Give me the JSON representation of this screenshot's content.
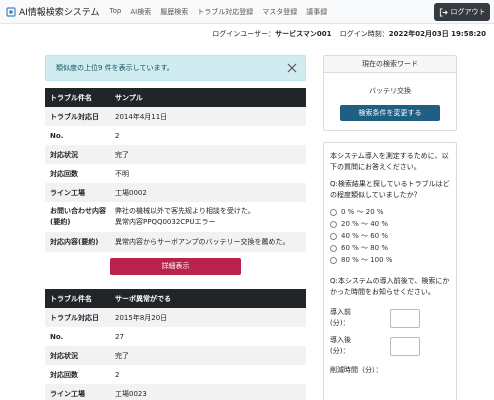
{
  "navbar": {
    "brand": "AI情報検索システム",
    "links": [
      "Top",
      "AI検索",
      "履歴検索",
      "トラブル対応登録",
      "マスタ登録",
      "議事録"
    ],
    "logout": "ログアウト"
  },
  "login": {
    "user_label": "ログインユーザー：",
    "user": "サービスマン001",
    "time_label": "ログイン時刻：",
    "time": "2022年02月03日 19:58:20"
  },
  "alert": {
    "text": "類似度の上位9 件を表示しています。"
  },
  "results": [
    {
      "rows": [
        {
          "k": "トラブル件名",
          "v": "サンプル"
        },
        {
          "k": "トラブル対応日",
          "v": "2014年4月11日"
        },
        {
          "k": "No.",
          "v": "2"
        },
        {
          "k": "対応状況",
          "v": "完了"
        },
        {
          "k": "対応回数",
          "v": "不明"
        },
        {
          "k": "ライン工場",
          "v": "工場0002"
        },
        {
          "k": "お問い合わせ内容(要約)",
          "v": "弊社の機械以外で客先规より相談を受けた。\n異常内容PPQQ0032CPUエラー"
        },
        {
          "k": "対応内容(要約)",
          "v": "異常内容からサーボアンプのバッテリー交換を薦めた。"
        }
      ],
      "button": "詳細表示"
    },
    {
      "rows": [
        {
          "k": "トラブル件名",
          "v": "サーボ異常がでる"
        },
        {
          "k": "トラブル対応日",
          "v": "2015年8月20日"
        },
        {
          "k": "No.",
          "v": "27"
        },
        {
          "k": "対応状況",
          "v": "完了"
        },
        {
          "k": "対応回数",
          "v": "2"
        },
        {
          "k": "ライン工場",
          "v": "工場0023"
        }
      ]
    }
  ],
  "keyword_card": {
    "title": "現在の検索ワード",
    "keyword": "バッテリ交換",
    "button": "検索条件を変更する"
  },
  "survey": {
    "intro": "本システム導入を測定するために、以下の質問にお答えください。",
    "q1": "Q:検索結果と探しているトラブルはどの程度類似していましたか？",
    "options": [
      "0 % ～ 20 %",
      "20 % ～ 40 %",
      "40 % ～ 60 %",
      "60 % ～ 80 %",
      "80 % ～ 100 %"
    ],
    "q2": "Q:本システムの導入前後で、検索にかかった時間をお知らせください。",
    "before": "導入前\n(分)：",
    "after": "導入後\n(分)：",
    "reduction": "削減時間（分）："
  }
}
